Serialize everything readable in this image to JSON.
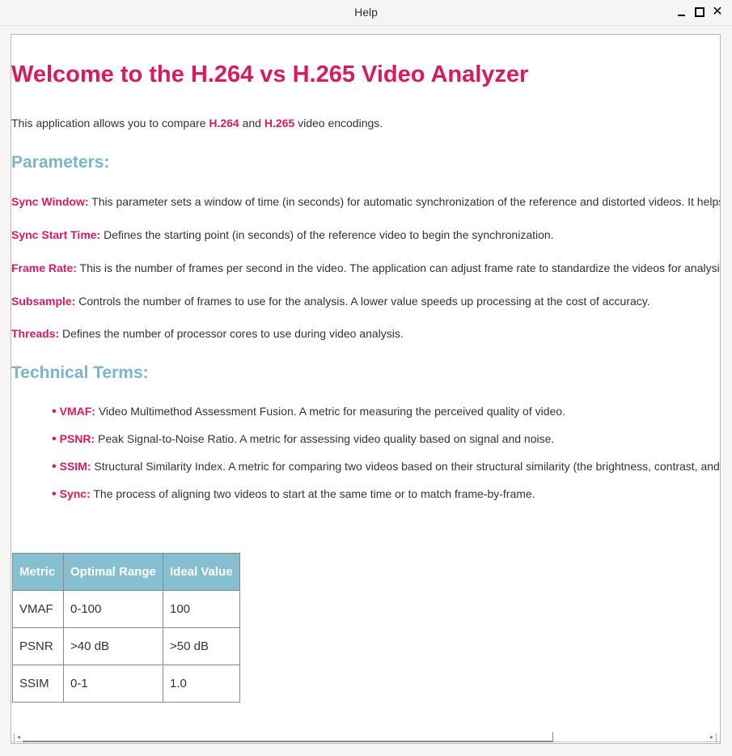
{
  "window": {
    "title": "Help"
  },
  "page": {
    "heading": "Welcome to the H.264 vs H.265 Video Analyzer",
    "intro": {
      "before": "This application allows you to compare ",
      "codec1": "H.264",
      "middle": " and ",
      "codec2": "H.265",
      "after": " video encodings."
    },
    "parameters_heading": "Parameters:",
    "parameters": [
      {
        "name": "Sync Window:",
        "text": " This parameter sets a window of time (in seconds) for automatic synchronization of the reference and distorted videos. It helps"
      },
      {
        "name": "Sync Start Time:",
        "text": " Defines the starting point (in seconds) of the reference video to begin the synchronization."
      },
      {
        "name": "Frame Rate:",
        "text": " This is the number of frames per second in the video. The application can adjust frame rate to standardize the videos for analysis"
      },
      {
        "name": "Subsample:",
        "text": " Controls the number of frames to use for the analysis. A lower value speeds up processing at the cost of accuracy."
      },
      {
        "name": "Threads:",
        "text": " Defines the number of processor cores to use during video analysis."
      }
    ],
    "terms_heading": "Technical Terms:",
    "terms": [
      {
        "bullet": "•",
        "name": "VMAF:",
        "text": " Video Multimethod Assessment Fusion. A metric for measuring the perceived quality of video."
      },
      {
        "bullet": "•",
        "name": "PSNR:",
        "text": " Peak Signal-to-Noise Ratio. A metric for assessing video quality based on signal and noise."
      },
      {
        "bullet": "•",
        "name": "SSIM:",
        "text": " Structural Similarity Index. A metric for comparing two videos based on their structural similarity (the brightness, contrast, and"
      },
      {
        "bullet": "•",
        "name": "Sync:",
        "text": " The process of aligning two videos to start at the same time or to match frame-by-frame."
      }
    ],
    "table": {
      "headers": [
        "Metric",
        "Optimal Range",
        "Ideal Value"
      ],
      "rows": [
        [
          "VMAF",
          "0-100",
          "100"
        ],
        [
          "PSNR",
          ">40 dB",
          ">50 dB"
        ],
        [
          "SSIM",
          "0-1",
          "1.0"
        ]
      ]
    }
  },
  "colors": {
    "accent": "#d81b5e",
    "section_heading": "#7ab5cb",
    "table_header": "#86bfcf"
  },
  "icons": {
    "minimize": "minimize-icon",
    "maximize": "maximize-icon",
    "close": "close-icon",
    "scroll_left": "scroll-left-arrow-icon",
    "scroll_right": "scroll-right-arrow-icon"
  }
}
